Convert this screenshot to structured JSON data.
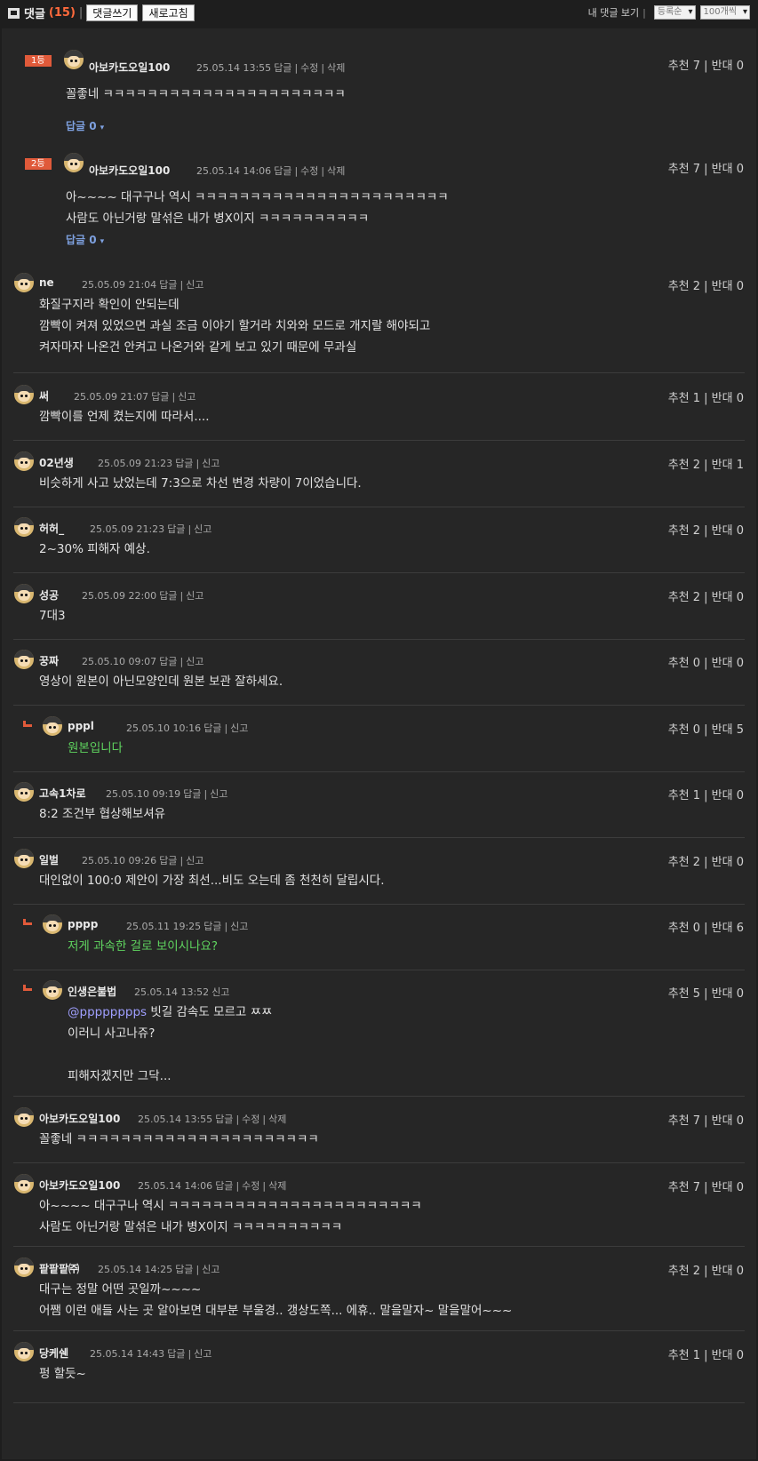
{
  "topbar": {
    "title": "댓글",
    "count": "(15)",
    "write_label": "댓글쓰기",
    "refresh_label": "새로고침",
    "my_comments_label": "내 댓글 보기",
    "sort_value": "등록순",
    "page_size_value": "100개씩"
  },
  "best": [
    {
      "badge": "1등",
      "nick": "아보카도오일100",
      "time": "25.05.14 13:55",
      "actions": [
        "답글",
        "수정",
        "삭제"
      ],
      "votes": "추천 7 | 반대 0",
      "lines": [
        "꼴좋네 ㅋㅋㅋㅋㅋㅋㅋㅋㅋㅋㅋㅋㅋㅋㅋㅋㅋㅋㅋㅋㅋㅋ"
      ],
      "reply": "답글 0"
    },
    {
      "badge": "2등",
      "nick": "아보카도오일100",
      "time": "25.05.14 14:06",
      "actions": [
        "답글",
        "수정",
        "삭제"
      ],
      "votes": "추천 7 | 반대 0",
      "lines": [
        "아~~~~ 대구구나 역시 ㅋㅋㅋㅋㅋㅋㅋㅋㅋㅋㅋㅋㅋㅋㅋㅋㅋㅋㅋㅋㅋㅋㅋ",
        "사람도 아닌거랑 말섞은 내가 병X이지 ㅋㅋㅋㅋㅋㅋㅋㅋㅋㅋ"
      ],
      "reply": "답글 0"
    }
  ],
  "comments": [
    {
      "nick": "ne",
      "time": "25.05.09 21:04",
      "actions": [
        "답글",
        "신고"
      ],
      "votes": "추천 2 | 반대 0",
      "lines": [
        "화질구지라 확인이 안되는데",
        "깜빡이 켜져 있었으면 과실 조금 이야기 할거라 치와와 모드로 개지랄 해야되고",
        "켜자마자 나온건 안켜고 나온거와 같게 보고 있기 때문에 무과실"
      ]
    },
    {
      "nick": "써",
      "time": "25.05.09 21:07",
      "actions": [
        "답글",
        "신고"
      ],
      "votes": "추천 1 | 반대 0",
      "lines": [
        "깜빡이를 언제 켰는지에 따라서...."
      ]
    },
    {
      "nick": "02년생",
      "time": "25.05.09 21:23",
      "actions": [
        "답글",
        "신고"
      ],
      "votes": "추천 2 | 반대 1",
      "lines": [
        "비슷하게 사고 났었는데 7:3으로 차선 변경 차량이 7이었습니다."
      ]
    },
    {
      "nick": "허허_",
      "time": "25.05.09 21:23",
      "actions": [
        "답글",
        "신고"
      ],
      "votes": "추천 2 | 반대 0",
      "lines": [
        "2~30% 피해자 예상."
      ]
    },
    {
      "nick": "성공",
      "time": "25.05.09 22:00",
      "actions": [
        "답글",
        "신고"
      ],
      "votes": "추천 2 | 반대 0",
      "lines": [
        "7대3"
      ]
    },
    {
      "nick": "꿍짜",
      "time": "25.05.10 09:07",
      "actions": [
        "답글",
        "신고"
      ],
      "votes": "추천 0 | 반대 0",
      "lines": [
        "영상이 원본이 아닌모양인데 원본 보관 잘하세요."
      ]
    },
    {
      "nick": "pppl",
      "time": "25.05.10 10:16",
      "actions": [
        "답글",
        "신고"
      ],
      "votes": "추천 0 | 반대 5",
      "lines": [
        "원본입니다"
      ],
      "reply": true,
      "green": true
    },
    {
      "nick": "고속1차로",
      "time": "25.05.10 09:19",
      "actions": [
        "답글",
        "신고"
      ],
      "votes": "추천 1 | 반대 0",
      "lines": [
        "8:2 조건부 협상해보셔유"
      ]
    },
    {
      "nick": "일벌",
      "time": "25.05.10 09:26",
      "actions": [
        "답글",
        "신고"
      ],
      "votes": "추천 2 | 반대 0",
      "lines": [
        "대인없이 100:0 제안이 가장 최선...비도 오는데 좀 천천히 달립시다."
      ]
    },
    {
      "nick": "pppp",
      "time": "25.05.11 19:25",
      "actions": [
        "답글",
        "신고"
      ],
      "votes": "추천 0 | 반대 6",
      "lines": [
        "저게 과속한 걸로 보이시나요?"
      ],
      "reply": true,
      "green": true
    },
    {
      "nick": "인생은불법",
      "time": "25.05.14 13:52",
      "actions": [
        "신고"
      ],
      "votes": "추천 5 | 반대 0",
      "mention": "@pppppppps",
      "lines": [
        " 빗길 감속도 모르고 ㅉㅉ",
        "이러니 사고나쥬?",
        "",
        "피해자겠지만 그닥..."
      ],
      "reply": true
    },
    {
      "nick": "아보카도오일100",
      "time": "25.05.14 13:55",
      "actions": [
        "답글",
        "수정",
        "삭제"
      ],
      "votes": "추천 7 | 반대 0",
      "lines": [
        "꼴좋네 ㅋㅋㅋㅋㅋㅋㅋㅋㅋㅋㅋㅋㅋㅋㅋㅋㅋㅋㅋㅋㅋㅋ"
      ]
    },
    {
      "nick": "아보카도오일100",
      "time": "25.05.14 14:06",
      "actions": [
        "답글",
        "수정",
        "삭제"
      ],
      "votes": "추천 7 | 반대 0",
      "lines": [
        "아~~~~ 대구구나 역시 ㅋㅋㅋㅋㅋㅋㅋㅋㅋㅋㅋㅋㅋㅋㅋㅋㅋㅋㅋㅋㅋㅋㅋ",
        "사람도 아닌거랑 말섞은 내가 병X이지 ㅋㅋㅋㅋㅋㅋㅋㅋㅋㅋ"
      ]
    },
    {
      "nick": "팥팥팥㈜",
      "time": "25.05.14 14:25",
      "actions": [
        "답글",
        "신고"
      ],
      "votes": "추천 2 | 반대 0",
      "lines": [
        "대구는 정말 어떤 곳일까~~~~",
        "어쨈 이런 애들 사는 곳 알아보면 대부분 부울경.. 갱상도쪽... 에휴.. 말을말자~ 말을말어~~~"
      ]
    },
    {
      "nick": "당케쉔",
      "time": "25.05.14 14:43",
      "actions": [
        "답글",
        "신고"
      ],
      "votes": "추천 1 | 반대 0",
      "lines": [
        "펑 할듯~"
      ]
    }
  ],
  "colors": {
    "accent": "#e05a3a",
    "link": "#7ea1e0",
    "green_text": "#5fd45f",
    "mention": "#9f9fff"
  }
}
